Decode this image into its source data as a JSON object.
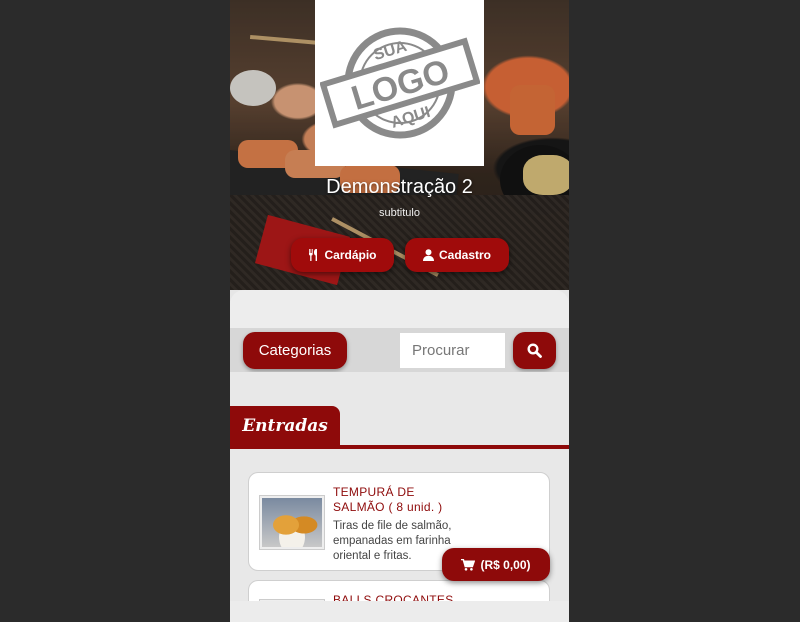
{
  "hero": {
    "logo_alt": "SUA LOGO AQUI",
    "logo_words": [
      "SUA",
      "LOGO",
      "AQUI"
    ],
    "title": "Demonstração 2",
    "subtitle": "subtitulo",
    "menu_button": "Cardápio",
    "register_button": "Cadastro",
    "menu_icon": "fork-knife-icon",
    "register_icon": "user-icon"
  },
  "toolbar": {
    "categories_button": "Categorias",
    "search_placeholder": "Procurar",
    "search_icon": "search-icon"
  },
  "section": {
    "title": "Entradas"
  },
  "items": [
    {
      "name": "TEMPURÁ DE SALMÃO ( 8 unid. )",
      "description": "Tiras de file de salmão, empanadas em farinha oriental e fritas."
    },
    {
      "name": "BALLS CROCANTES (",
      "description": ""
    }
  ],
  "cart": {
    "label": "(R$ 0,00)",
    "icon": "cart-icon"
  },
  "colors": {
    "accent": "#8e0a0a",
    "background": "#2b2b2b"
  }
}
